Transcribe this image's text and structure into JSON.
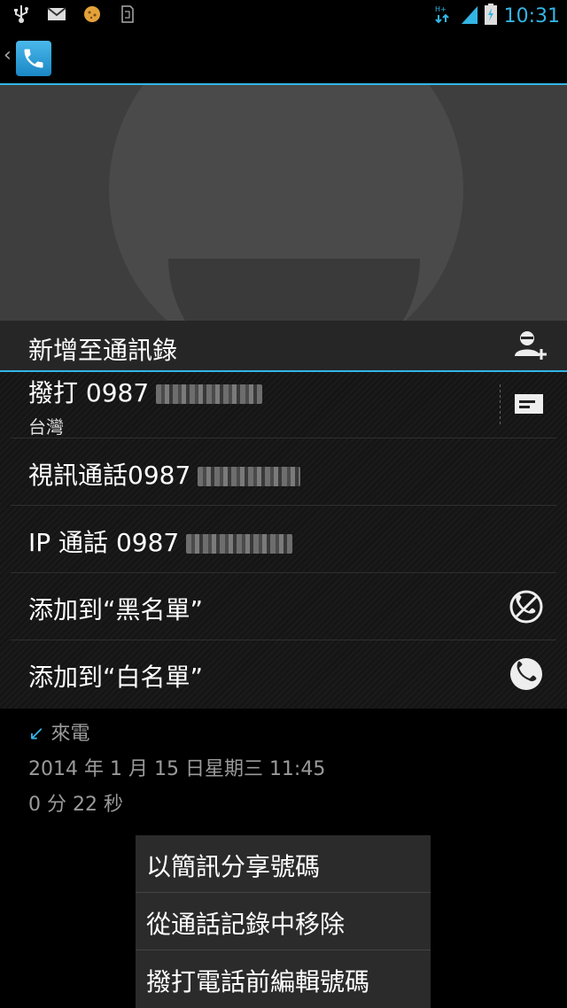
{
  "status_bar": {
    "time": "10:31",
    "left_icons": [
      "usb-icon",
      "mail-icon",
      "cookie-icon",
      "sd-card-icon"
    ],
    "right_icons": [
      "data-hplus-icon",
      "signal-icon",
      "battery-charging-icon"
    ]
  },
  "action_bar": {
    "app_icon": "phone-app-icon"
  },
  "add_contact": {
    "label": "新增至通訊錄",
    "icon": "add-person-icon"
  },
  "actions": {
    "call": {
      "prefix": "撥打 0987",
      "location": "台灣",
      "sms_icon": "message-icon"
    },
    "video_call": {
      "prefix": "視訊通話0987"
    },
    "ip_call": {
      "prefix": "IP 通話 0987"
    },
    "blacklist": {
      "label": "添加到“黑名單”",
      "icon": "blocked-phone-icon"
    },
    "whitelist": {
      "label": "添加到“白名單”",
      "icon": "phone-icon"
    }
  },
  "call_details": {
    "type": "來電",
    "datetime": "2014 年 1 月 15 日星期三 11:45",
    "duration": "0 分 22 秒"
  },
  "context_menu": {
    "items": [
      "以簡訊分享號碼",
      "從通話記錄中移除",
      "撥打電話前編輯號碼"
    ]
  },
  "colors": {
    "accent": "#33b5e5",
    "background": "#000000"
  }
}
